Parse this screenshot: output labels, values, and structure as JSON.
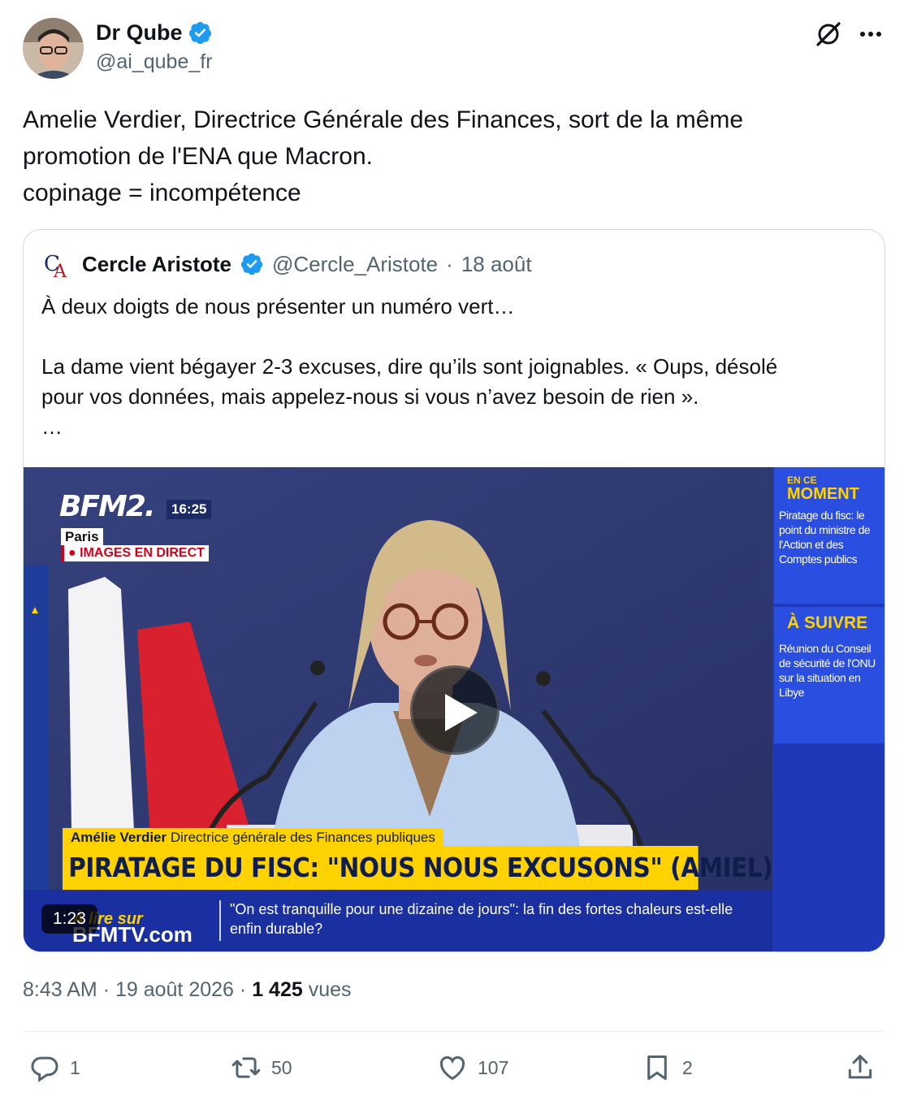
{
  "author": {
    "name": "Dr Qube",
    "handle": "@ai_qube_fr",
    "verified": true
  },
  "header_icons": [
    "grok-icon",
    "more-icon"
  ],
  "tweet": {
    "lines": [
      "Amelie Verdier, Directrice Générale des Finances, sort de la même",
      "promotion de l'ENA que Macron.",
      "copinage = incompétence"
    ]
  },
  "quote": {
    "name": "Cercle Aristote",
    "handle": "@Cercle_Aristote",
    "separator": "·",
    "date": "18 août",
    "lines": [
      "À deux doigts de nous présenter un numéro vert…",
      "",
      "La dame vient bégayer 2-3 excuses, dire qu’ils sont joignables. « Oups, désolé",
      "pour vos données, mais appelez-nous si vous n’avez besoin de rien ».",
      "…"
    ],
    "video": {
      "channel": "BFM2.",
      "time": "16:25",
      "location": "Paris",
      "live_label": "● IMAGES EN DIRECT",
      "side": {
        "now_small": "EN CE",
        "now_big": "MOMENT",
        "now_text": "Piratage du fisc: le point du ministre de l'Action et des Comptes publics",
        "next_title": "À SUIVRE",
        "next_text": "Réunion du Conseil de sécurité de l'ONU sur la situation en Libye"
      },
      "person_name": "Amélie Verdier",
      "person_title": "Directrice générale des Finances publiques",
      "headline": "PIRATAGE DU FISC: \"NOUS NOUS EXCUSONS\" (AMIEL)",
      "ticker_logo_top": "À lire sur",
      "ticker_logo_bottom": "BFMTV.com",
      "ticker_text": "\"On est tranquille pour une dizaine de jours\": la fin des fortes chaleurs est-elle enfin durable?",
      "duration": "1:23"
    }
  },
  "meta": {
    "time": "8:43 AM",
    "sep": "·",
    "date": "19 août 2026",
    "views_count": "1 425",
    "views_label": "vues"
  },
  "actions": {
    "replies": "1",
    "reposts": "50",
    "likes": "107",
    "bookmarks": "2"
  },
  "colors": {
    "text": "#0f1419",
    "secondary": "#536471",
    "verified": "#1d9bf0",
    "border": "#cfd9de"
  }
}
